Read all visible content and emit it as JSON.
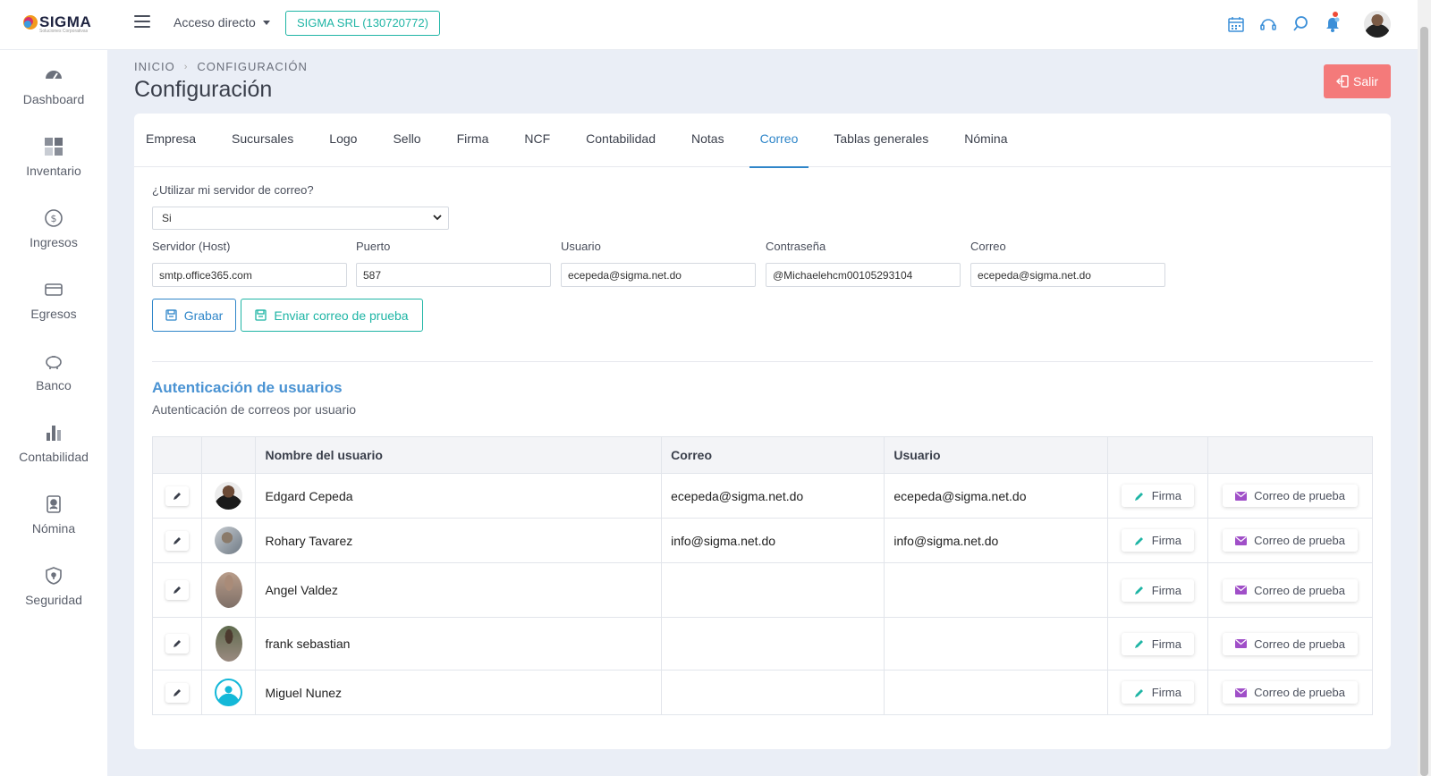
{
  "header": {
    "logo_text": "SIGMA",
    "logo_subtitle": "Soluciones Corporativas",
    "shortcut_label": "Acceso directo",
    "company_label": "SIGMA SRL (130720772)"
  },
  "sidebar": {
    "items": [
      {
        "label": "Dashboard",
        "icon": "dashboard-gauge-icon"
      },
      {
        "label": "Inventario",
        "icon": "grid-icon"
      },
      {
        "label": "Ingresos",
        "icon": "dollar-coin-icon"
      },
      {
        "label": "Egresos",
        "icon": "credit-card-icon"
      },
      {
        "label": "Banco",
        "icon": "piggy-bank-icon"
      },
      {
        "label": "Contabilidad",
        "icon": "bar-chart-icon"
      },
      {
        "label": "Nómina",
        "icon": "id-badge-icon"
      },
      {
        "label": "Seguridad",
        "icon": "shield-icon"
      }
    ]
  },
  "breadcrumb": {
    "home": "INICIO",
    "current": "CONFIGURACIÓN"
  },
  "page_title": "Configuración",
  "exit_label": "Salir",
  "tabs": [
    {
      "label": "Empresa"
    },
    {
      "label": "Sucursales"
    },
    {
      "label": "Logo"
    },
    {
      "label": "Sello"
    },
    {
      "label": "Firma"
    },
    {
      "label": "NCF"
    },
    {
      "label": "Contabilidad"
    },
    {
      "label": "Notas"
    },
    {
      "label": "Correo",
      "active": true
    },
    {
      "label": "Tablas generales"
    },
    {
      "label": "Nómina"
    }
  ],
  "mail_form": {
    "use_server_label": "¿Utilizar mi servidor de correo?",
    "use_server_value": "Si",
    "host_label": "Servidor (Host)",
    "host_value": "smtp.office365.com",
    "port_label": "Puerto",
    "port_value": "587",
    "user_label": "Usuario",
    "user_value": "ecepeda@sigma.net.do",
    "password_label": "Contraseña",
    "password_value": "@Michaelehcm00105293104",
    "email_label": "Correo",
    "email_value": "ecepeda@sigma.net.do",
    "save_label": "Grabar",
    "send_test_label": "Enviar correo de prueba"
  },
  "auth_section": {
    "title": "Autenticación de usuarios",
    "subtitle": "Autenticación de correos por usuario",
    "columns": [
      "",
      "",
      "Nombre del usuario",
      "Correo",
      "Usuario",
      "",
      ""
    ],
    "sign_label": "Firma",
    "test_mail_label": "Correo de prueba",
    "rows": [
      {
        "name": "Edgard Cepeda",
        "email": "ecepeda@sigma.net.do",
        "user": "ecepeda@sigma.net.do"
      },
      {
        "name": "Rohary Tavarez",
        "email": "info@sigma.net.do",
        "user": "info@sigma.net.do"
      },
      {
        "name": "Angel Valdez",
        "email": "",
        "user": ""
      },
      {
        "name": "frank sebastian",
        "email": "",
        "user": ""
      },
      {
        "name": "Miguel Nunez",
        "email": "",
        "user": ""
      }
    ]
  },
  "colors": {
    "accent": "#2f86c9",
    "teal": "#1fb5a5",
    "danger": "#f47a7a",
    "section_title": "#4a93d3"
  }
}
